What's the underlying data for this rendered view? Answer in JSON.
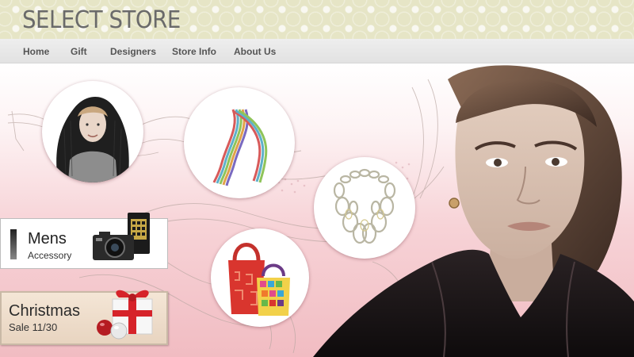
{
  "site": {
    "logo": "SELECT STORE"
  },
  "nav": {
    "items": [
      {
        "label": "Home"
      },
      {
        "label": "Gift"
      },
      {
        "label": "Designers"
      },
      {
        "label": "Store Info"
      },
      {
        "label": "About Us"
      }
    ]
  },
  "promos": {
    "mens": {
      "title": "Mens",
      "subtitle": "Accessory"
    },
    "christmas": {
      "title": "Christmas",
      "subtitle": "Sale 11/30"
    }
  },
  "products": [
    {
      "name": "hooded-knit-scarf-model"
    },
    {
      "name": "striped-scarf"
    },
    {
      "name": "silver-link-necklace"
    },
    {
      "name": "patterned-tote-bags"
    }
  ],
  "colors": {
    "header_bg": "#e6e5c6",
    "nav_bg": "#e8e8e8",
    "banner_pink": "#f1bcc2",
    "logo_text": "#6a6a6a"
  }
}
